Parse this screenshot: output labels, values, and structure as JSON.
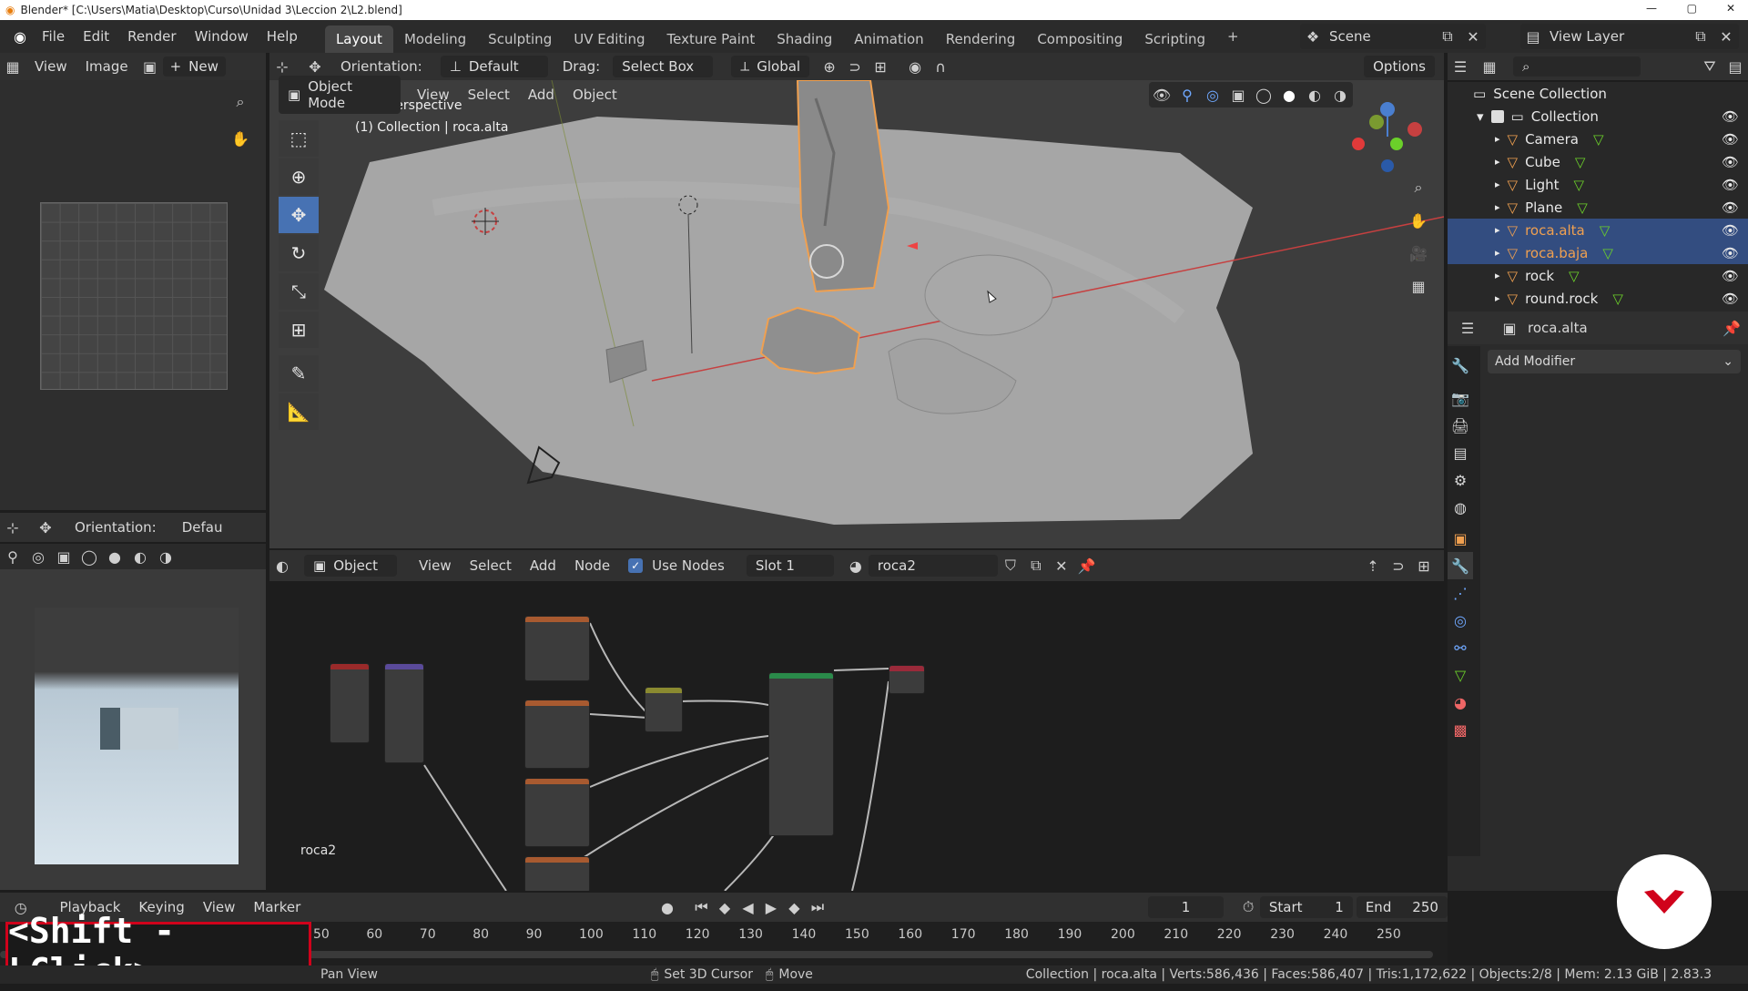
{
  "window": {
    "title": "Blender* [C:\\Users\\Matia\\Desktop\\Curso\\Unidad 3\\Leccion 2\\L2.blend]",
    "min": "—",
    "max": "▢",
    "close": "✕"
  },
  "menu": {
    "items": [
      "File",
      "Edit",
      "Render",
      "Window",
      "Help"
    ]
  },
  "workspaces": [
    "Layout",
    "Modeling",
    "Sculpting",
    "UV Editing",
    "Texture Paint",
    "Shading",
    "Animation",
    "Rendering",
    "Compositing",
    "Scripting"
  ],
  "workspace_add": "+",
  "scene": {
    "name": "Scene",
    "view_layer": "View Layer"
  },
  "image_editor": {
    "view": "View",
    "image": "Image",
    "new": "New"
  },
  "viewport": {
    "orientation_label": "Orientation:",
    "orientation_value": "Default",
    "drag_label": "Drag:",
    "drag_value": "Select Box",
    "transform_value": "Global",
    "options": "Options",
    "mode": "Object Mode",
    "menus": [
      "View",
      "Select",
      "Add",
      "Object"
    ],
    "overlay_title": "User Perspective",
    "overlay_sub": "(1) Collection | roca.alta"
  },
  "mini_viewport": {
    "orientation_label": "Orientation:",
    "orientation_value": "Defau"
  },
  "node_editor": {
    "type": "Object",
    "menus": [
      "View",
      "Select",
      "Add",
      "Node"
    ],
    "use_nodes": "Use Nodes",
    "slot": "Slot 1",
    "material": "roca2",
    "label": "roca2"
  },
  "outliner": {
    "root": "Scene Collection",
    "collection": "Collection",
    "items": [
      {
        "name": "Camera",
        "sel": false
      },
      {
        "name": "Cube",
        "sel": false
      },
      {
        "name": "Light",
        "sel": false
      },
      {
        "name": "Plane",
        "sel": false
      },
      {
        "name": "roca.alta",
        "sel": true
      },
      {
        "name": "roca.baja",
        "sel": true
      },
      {
        "name": "rock",
        "sel": false
      },
      {
        "name": "round.rock",
        "sel": false
      }
    ]
  },
  "properties": {
    "object": "roca.alta",
    "add_modifier": "Add Modifier"
  },
  "timeline": {
    "menus": [
      "Playback",
      "Keying",
      "View",
      "Marker"
    ],
    "current_frame": "1",
    "start_label": "Start",
    "start": "1",
    "end_label": "End",
    "end": "250",
    "ticks": [
      "50",
      "60",
      "70",
      "80",
      "90",
      "100",
      "110",
      "120",
      "130",
      "140",
      "150",
      "160",
      "170",
      "180",
      "190",
      "200",
      "210",
      "220",
      "230",
      "240",
      "250"
    ]
  },
  "key_overlay": "<Shift - LClick>",
  "status": {
    "pan": "Pan View",
    "cursor": "Set 3D Cursor",
    "move": "Move",
    "stats": "Collection | roca.alta | Verts:586,436 | Faces:586,407 | Tris:1,172,622 | Objects:2/8 | Mem: 2.13 GiB | 2.83.3"
  },
  "colors": {
    "accent": "#4772b3",
    "selected_row": "#334d80",
    "selected_text": "#f0a050",
    "record": "#d0021b"
  }
}
